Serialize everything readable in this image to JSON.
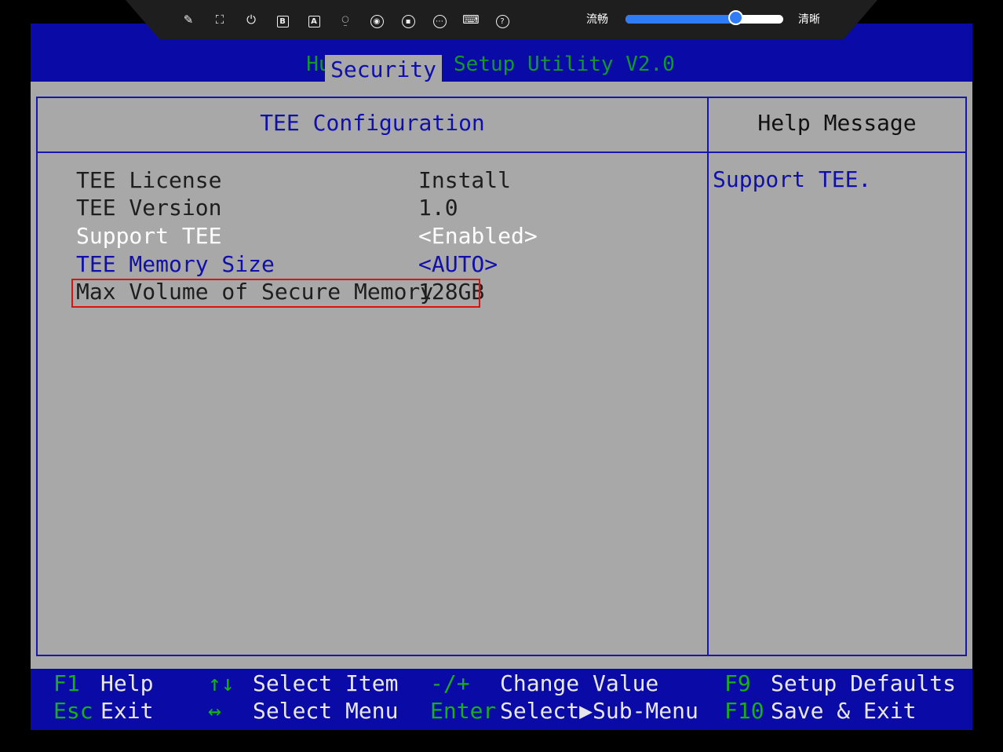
{
  "bios": {
    "title": "Huawei BIOS Setup Utility V2.0",
    "active_tab": "Security",
    "panel_title": "TEE Configuration",
    "help_title": "Help Message",
    "help_text": "Support TEE.",
    "items": [
      {
        "label": "TEE License",
        "value": "Install"
      },
      {
        "label": "TEE Version",
        "value": "1.0"
      },
      {
        "label": "Support TEE",
        "value": "<Enabled>"
      },
      {
        "label": "TEE Memory Size",
        "value": "<AUTO>"
      },
      {
        "label": "Max Volume of Secure Memory",
        "value": "128GB"
      }
    ],
    "footer": {
      "f1_key": "F1",
      "f1_desc": "Help",
      "esc_key": "Esc",
      "esc_desc": "Exit",
      "updown_key": "↑↓",
      "updown_desc": "Select Item",
      "leftright_key": "↔",
      "leftright_desc": "Select Menu",
      "minusplus_key": "-/+",
      "minusplus_desc": "Change Value",
      "enter_key": "Enter",
      "enter_desc": "Select▶Sub-Menu",
      "f9_key": "F9",
      "f9_desc": "Setup Defaults",
      "f10_key": "F10",
      "f10_desc": "Save & Exit"
    }
  },
  "toolbar": {
    "icons": [
      "pin-icon",
      "fullscreen-icon",
      "power-icon",
      "b-box-icon",
      "a-box-icon",
      "mouse-icon",
      "disc-icon",
      "record-icon",
      "keyboard-grid-icon",
      "keyboard-icon",
      "help-icon"
    ],
    "quality_low_label": "流畅",
    "quality_high_label": "清晰",
    "quality_level": 0.7,
    "accent_color": "#2f7cf6"
  }
}
